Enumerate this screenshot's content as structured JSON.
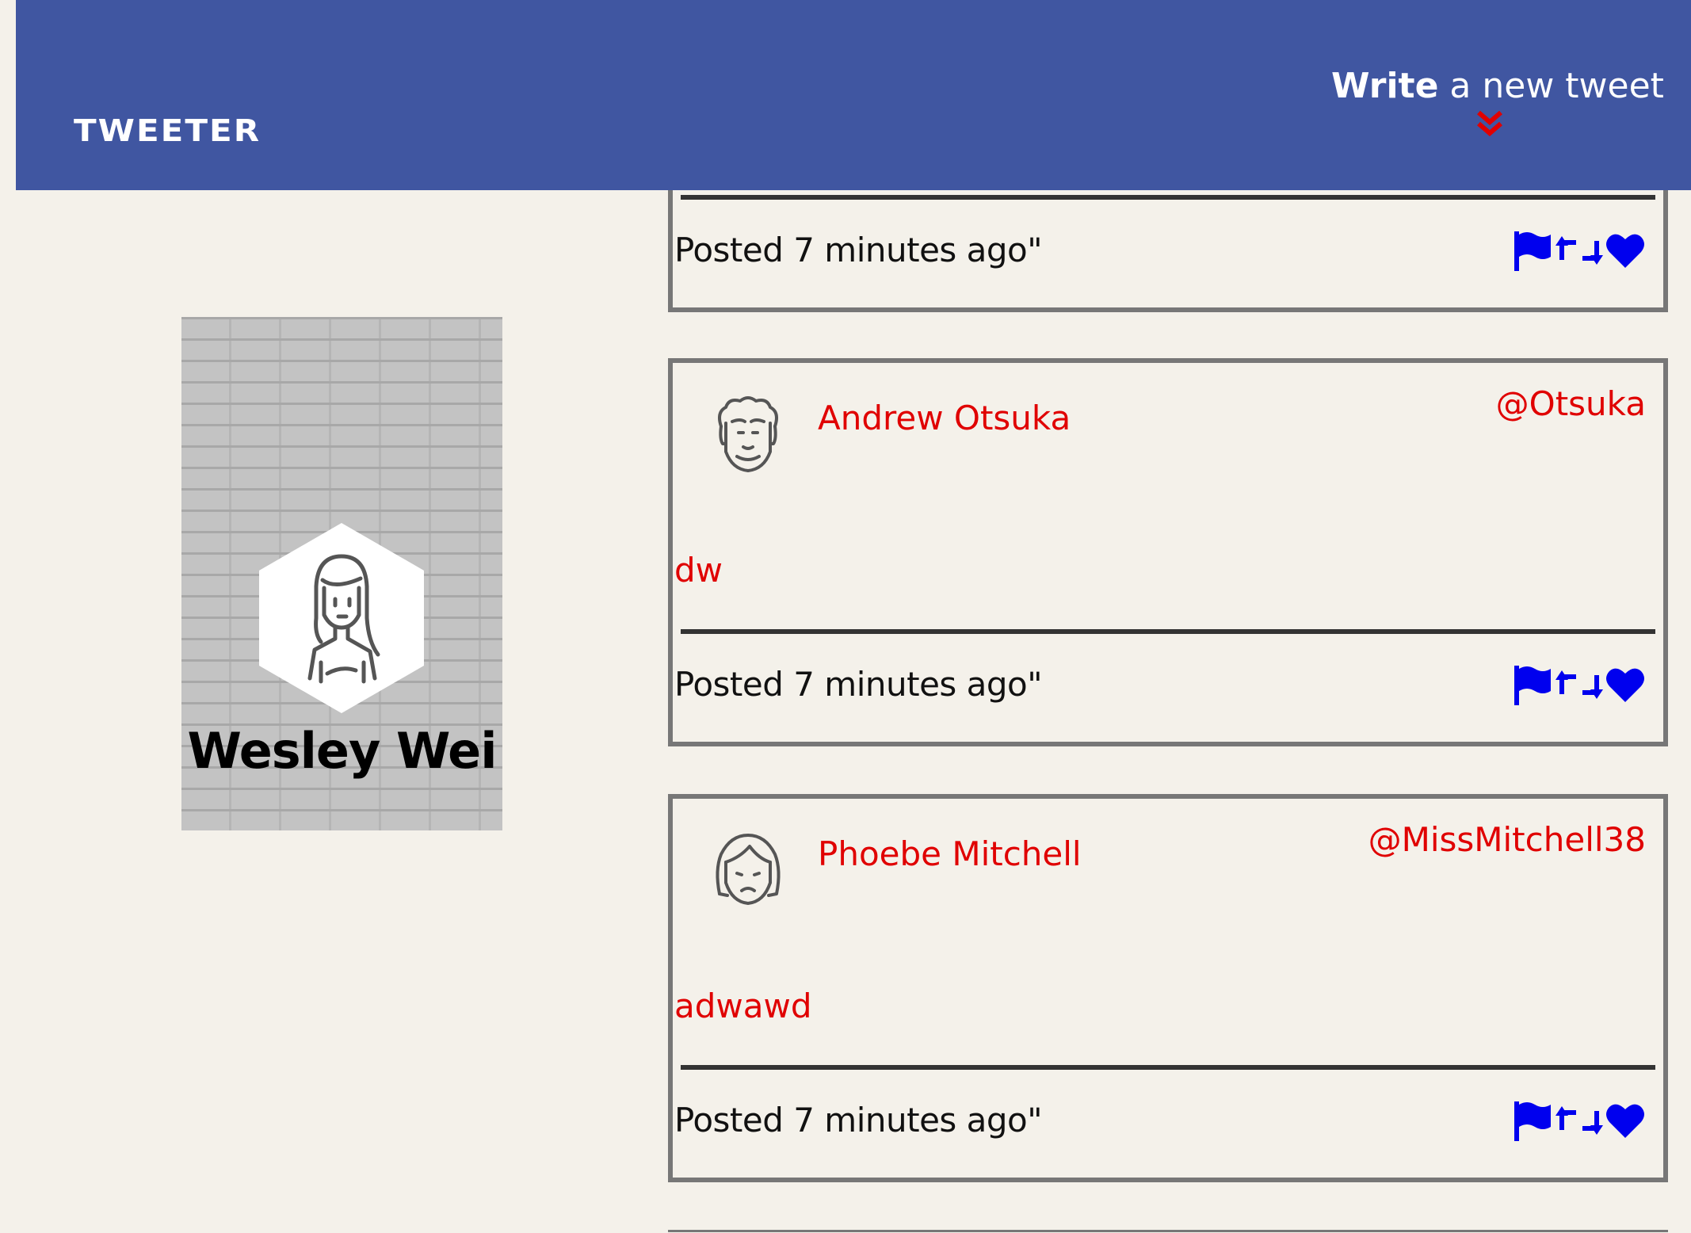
{
  "navbar": {
    "brand": "TWEETER",
    "compose_bold": "Write",
    "compose_rest": " a new tweet",
    "compose_icon": "double-chevron-down-icon",
    "accent_color": "#4056a1"
  },
  "profile": {
    "name": "Wesley Wei",
    "avatar_icon": "woman-avatar-icon"
  },
  "tweets": [
    {
      "name": "",
      "handle": "",
      "body": "",
      "time": "Posted 7 minutes ago\""
    },
    {
      "name": "Andrew Otsuka",
      "handle": "@Otsuka",
      "body": "dw",
      "time": "Posted 7 minutes ago\"",
      "avatar_icon": "curly-hair-man-avatar-icon"
    },
    {
      "name": "Phoebe Mitchell",
      "handle": "@MissMitchell38",
      "body": "adwawd",
      "time": "Posted 7 minutes ago\"",
      "avatar_icon": "frowning-woman-avatar-icon"
    }
  ],
  "actions": [
    "flag-icon",
    "retweet-icon",
    "heart-icon"
  ],
  "colors": {
    "background": "#f4f1ea",
    "name_red": "#e00000",
    "icon_blue": "#0000ee",
    "border_gray": "#777777"
  }
}
